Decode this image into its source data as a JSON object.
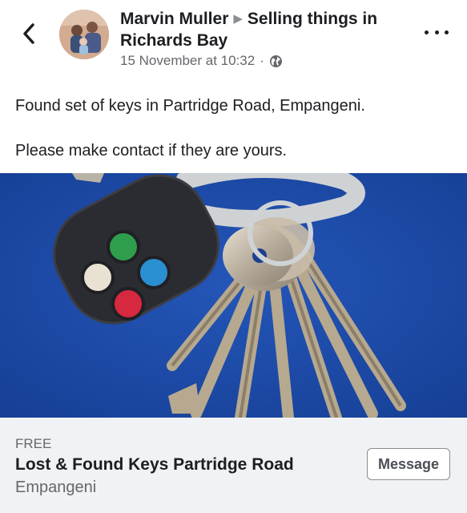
{
  "header": {
    "author": "Marvin Muller",
    "group": "Selling things in Richards Bay",
    "timestamp": "15 November at 10:32",
    "separator": "·",
    "privacy_icon": "globe-icon",
    "back_icon": "chevron-left-icon",
    "more_icon": "more-dots-icon"
  },
  "post": {
    "paragraphs": [
      "Found set of keys in Partridge Road, Empangeni.",
      "Please make contact if they are yours."
    ]
  },
  "photo": {
    "subject": "keys-photo",
    "colors": {
      "background": "#1d49a6",
      "fob": "#2b2c31",
      "button_green": "#2f9e4c",
      "button_blue": "#2a8fd0",
      "button_red": "#d6283f",
      "button_white": "#e9e2d3"
    }
  },
  "listing": {
    "price": "FREE",
    "title": "Lost & Found Keys Partridge Road",
    "location": "Empangeni",
    "message_button": "Message"
  }
}
